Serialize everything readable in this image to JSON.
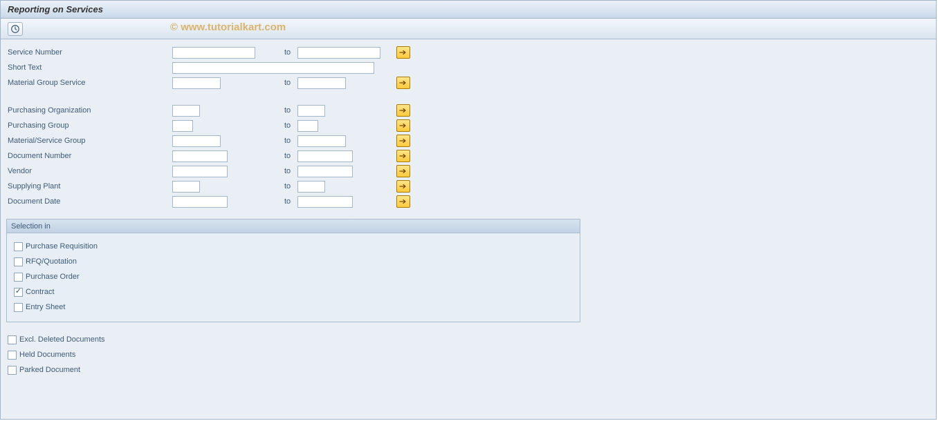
{
  "title": "Reporting on Services",
  "watermark": "© www.tutorialkart.com",
  "toLabel": "to",
  "fields": {
    "serviceNumber": {
      "label": "Service Number",
      "w1": 120,
      "w2": 120,
      "more": true
    },
    "shortText": {
      "label": "Short Text",
      "w1": 292,
      "w2": 0,
      "more": false
    },
    "materialGroupService": {
      "label": "Material Group Service",
      "w1": 70,
      "w2": 70,
      "more": true
    },
    "purchOrg": {
      "label": "Purchasing Organization",
      "w1": 40,
      "w2": 40,
      "more": true
    },
    "purchGroup": {
      "label": "Purchasing Group",
      "w1": 30,
      "w2": 30,
      "more": true
    },
    "matServGroup": {
      "label": "Material/Service Group",
      "w1": 70,
      "w2": 70,
      "more": true
    },
    "docNumber": {
      "label": "Document Number",
      "w1": 80,
      "w2": 80,
      "more": true
    },
    "vendor": {
      "label": "Vendor",
      "w1": 80,
      "w2": 80,
      "more": true
    },
    "supplyPlant": {
      "label": "Supplying Plant",
      "w1": 40,
      "w2": 40,
      "more": true
    },
    "docDate": {
      "label": "Document Date",
      "w1": 80,
      "w2": 80,
      "more": true
    }
  },
  "selectionGroup": {
    "title": "Selection in",
    "items": [
      {
        "label": "Purchase Requisition",
        "checked": false
      },
      {
        "label": "RFQ/Quotation",
        "checked": false
      },
      {
        "label": "Purchase Order",
        "checked": false
      },
      {
        "label": "Contract",
        "checked": true
      },
      {
        "label": "Entry Sheet",
        "checked": false
      }
    ]
  },
  "bottomChecks": [
    {
      "label": "Excl. Deleted Documents",
      "checked": false
    },
    {
      "label": "Held Documents",
      "checked": false
    },
    {
      "label": "Parked Document",
      "checked": false
    }
  ]
}
